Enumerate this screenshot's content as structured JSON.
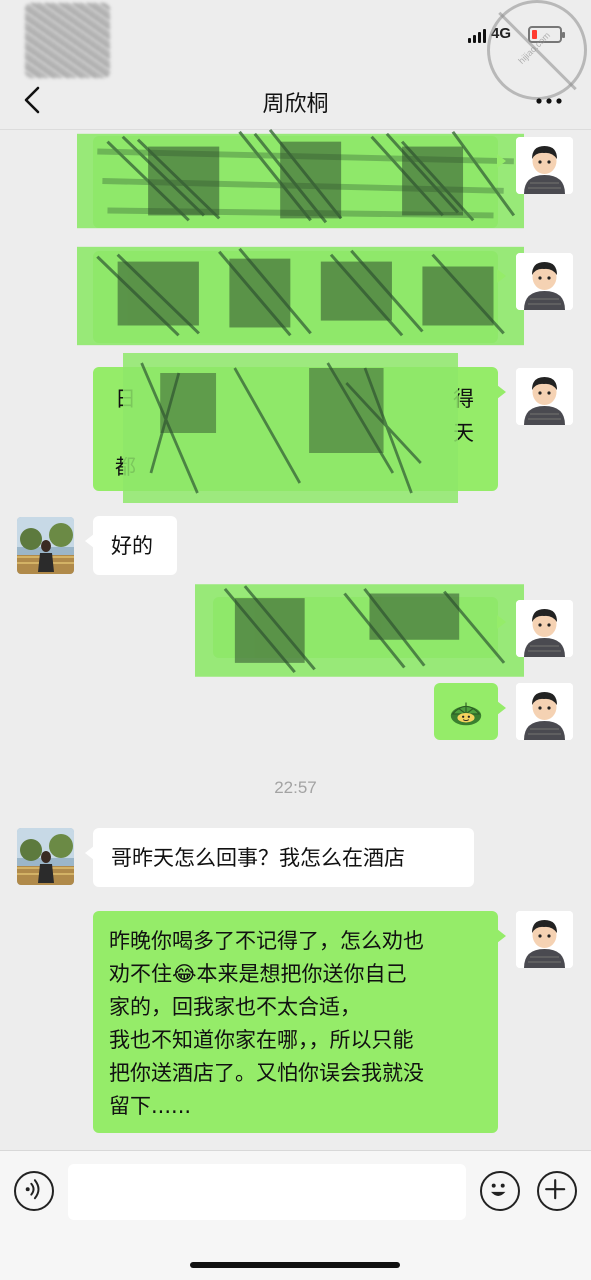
{
  "status_bar": {
    "network": "4G",
    "watermark_text": "hijiao.com"
  },
  "header": {
    "title": "周欣桐",
    "back_icon": "chevron-left-icon",
    "more_icon": "more-dots-icon"
  },
  "messages": [
    {
      "side": "right",
      "kind": "redacted"
    },
    {
      "side": "right",
      "kind": "redacted"
    },
    {
      "side": "right",
      "kind": "redacted",
      "partial_visible": [
        "日",
        "得",
        "天",
        "都"
      ]
    },
    {
      "side": "left",
      "kind": "text",
      "text": "好的"
    },
    {
      "side": "right",
      "kind": "redacted"
    },
    {
      "side": "right",
      "kind": "emoji",
      "emoji": "turtle-sticker-icon"
    },
    {
      "kind": "time",
      "text": "22:57"
    },
    {
      "side": "left",
      "kind": "text",
      "text": "哥昨天怎么回事？我怎么在酒店"
    },
    {
      "side": "right",
      "kind": "text",
      "lines": [
        "昨晚你喝多了不记得了，怎么劝也",
        "劝不住😂本来是想把你送你自己",
        "家的，回我家也不太合适，",
        "我也不知道你家在哪，，所以只能",
        "把你送酒店了。又怕你误会我就没",
        "留下......"
      ]
    }
  ],
  "input_bar": {
    "voice_icon": "voice-icon",
    "text_value": "",
    "emoji_icon": "smiley-icon",
    "plus_icon": "plus-icon"
  },
  "colors": {
    "background": "#ededed",
    "bubble_green": "#95ec69",
    "bubble_white": "#ffffff",
    "timestamp": "#a3a3a3",
    "battery_low": "#ff3b30"
  }
}
